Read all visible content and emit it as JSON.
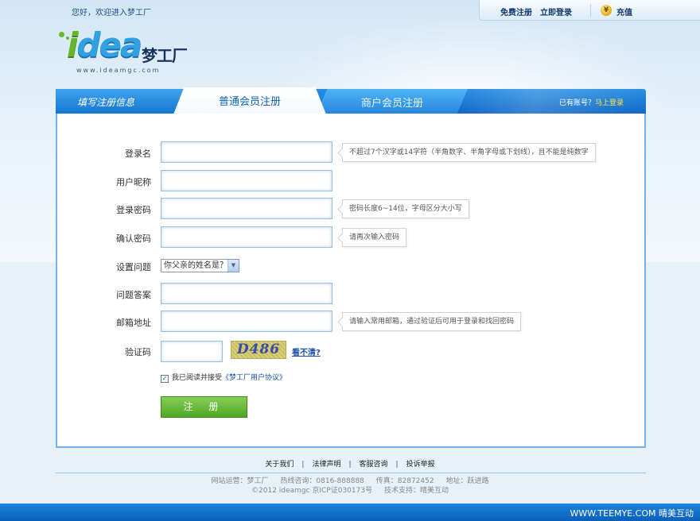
{
  "header": {
    "welcome": "您好，欢迎进入梦工厂",
    "register_link": "免费注册",
    "login_link": "立即登录",
    "recharge_icon_glyph": "¥",
    "recharge_link": "充值"
  },
  "logo": {
    "brand_word": "idea",
    "brand_cn": "梦工厂",
    "url": "www.ideamgc.com"
  },
  "tabs": {
    "fill_info": "填写注册信息",
    "member": "普通会员注册",
    "merchant": "商户会员注册",
    "active": "普通会员注册",
    "have_account": "已有账号？",
    "login_now": "马上登录"
  },
  "form": {
    "username": {
      "label": "登录名",
      "value": "",
      "hint": "不超过7个汉字或14字符（半角数字、半角字母或下划线），且不能是纯数字"
    },
    "nickname": {
      "label": "用户昵称",
      "value": ""
    },
    "password": {
      "label": "登录密码",
      "value": "",
      "hint": "密码长度6~14位，字母区分大小写"
    },
    "confirm": {
      "label": "确认密码",
      "value": "",
      "hint": "请再次输入密码"
    },
    "question": {
      "label": "设置问题",
      "selected": "你父亲的姓名是？",
      "arrow": "▼"
    },
    "answer": {
      "label": "问题答案",
      "value": ""
    },
    "email": {
      "label": "邮箱地址",
      "value": "",
      "hint": "请输入常用邮箱，通过验证后可用于登录和找回密码"
    },
    "captcha": {
      "label": "验证码",
      "value": "",
      "code": "D486",
      "refresh": "看不清?"
    },
    "agree": {
      "text": "我已阅读并接受",
      "link": "《梦工厂用户协议》",
      "checked": true,
      "check_mark": "✓"
    },
    "submit": "注 册"
  },
  "footer": {
    "links": [
      "关于我们",
      "法律声明",
      "客服咨询",
      "投诉举报"
    ],
    "separator": "|",
    "operator": "网站运营：梦工厂",
    "hotline": "热线咨询：0816-888888",
    "fax": "传真：82872452",
    "address": "地址：跃进路",
    "copyright": "©2012 ideamgc 京ICP证030173号",
    "tech": "技术支持：晴美互动",
    "brand_bar": "WWW.TEEMYE.COM 晴美互动"
  }
}
